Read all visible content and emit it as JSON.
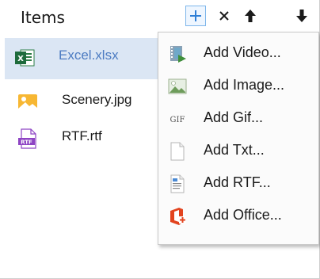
{
  "header": {
    "title": "Items",
    "buttons": {
      "add": "+",
      "remove": "×",
      "move_up": "arrow-up",
      "move_down": "arrow-down"
    }
  },
  "list": {
    "items": [
      {
        "label": "Excel.xlsx",
        "icon": "excel-file-icon",
        "selected": true
      },
      {
        "label": "Scenery.jpg",
        "icon": "image-file-icon",
        "selected": false
      },
      {
        "label": "RTF.rtf",
        "icon": "rtf-file-icon",
        "selected": false
      }
    ]
  },
  "menu": {
    "items": [
      {
        "label": "Add Video...",
        "icon": "video-icon"
      },
      {
        "label": "Add Image...",
        "icon": "image-icon"
      },
      {
        "label": "Add Gif...",
        "icon": "gif-icon",
        "icon_text": "GIF"
      },
      {
        "label": "Add Txt...",
        "icon": "txt-document-icon"
      },
      {
        "label": "Add RTF...",
        "icon": "rtf-document-icon"
      },
      {
        "label": "Add Office...",
        "icon": "office-icon"
      }
    ]
  },
  "colors": {
    "selected_bg": "#dbe6f4",
    "selected_text": "#4d7cc2",
    "add_button_border": "#7db5ea"
  }
}
